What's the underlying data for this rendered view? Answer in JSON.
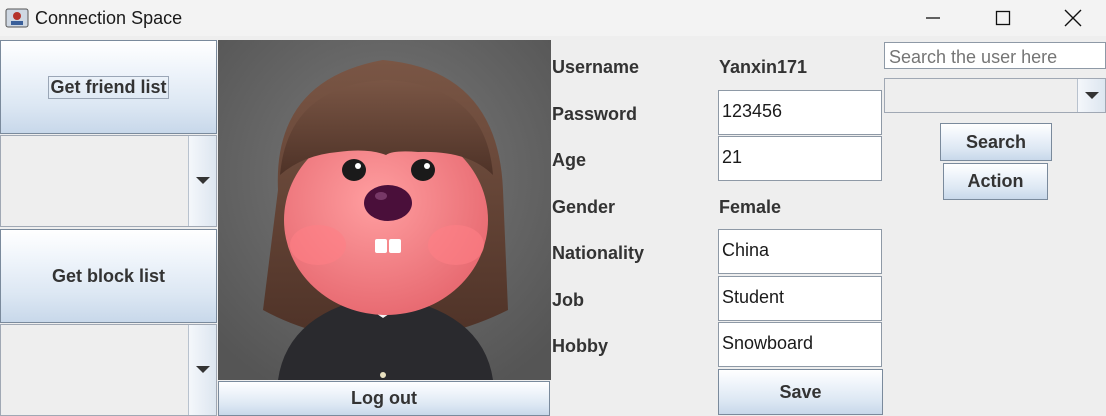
{
  "window": {
    "title": "Connection Space"
  },
  "left_panel": {
    "friend_list_button": "Get friend list",
    "block_list_button": "Get block list",
    "friend_combo_value": "",
    "block_combo_value": ""
  },
  "profile": {
    "logout_button": "Log out",
    "fields": {
      "username": {
        "label": "Username",
        "value": "Yanxin171"
      },
      "password": {
        "label": "Password",
        "value": "123456"
      },
      "age": {
        "label": "Age",
        "value": "21"
      },
      "gender": {
        "label": "Gender",
        "value": "Female"
      },
      "nationality": {
        "label": "Nationality",
        "value": "China"
      },
      "job": {
        "label": "Job",
        "value": "Student"
      },
      "hobby": {
        "label": "Hobby",
        "value": "Snowboard"
      }
    },
    "save_button": "Save"
  },
  "search": {
    "placeholder": "Search the user here",
    "combo_value": "",
    "search_button": "Search",
    "action_button": "Action"
  },
  "colors": {
    "avatar_background": "#5c5c5c",
    "button_gradient_top": "#ffffff",
    "button_gradient_bottom": "#c8d8ea"
  }
}
